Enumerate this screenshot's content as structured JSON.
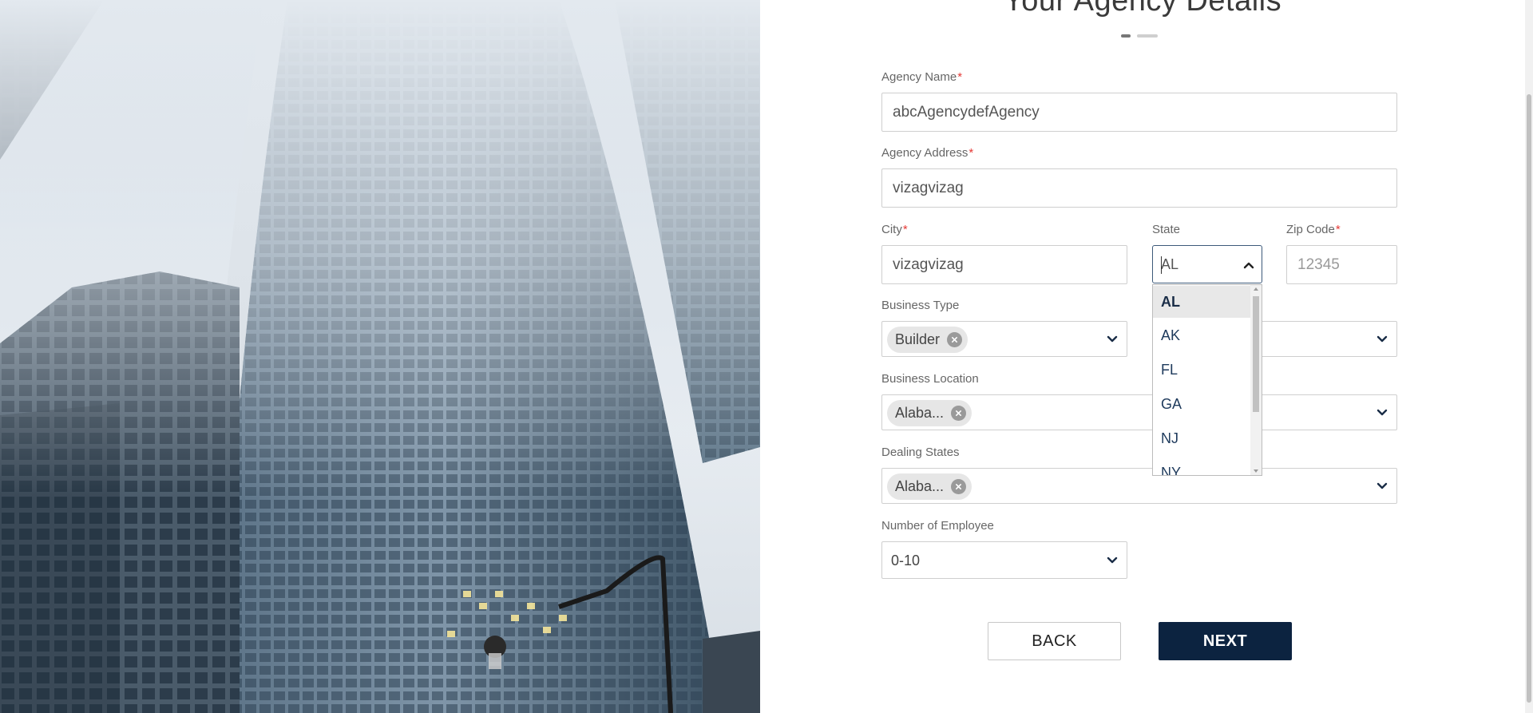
{
  "page": {
    "title": "Your Agency Details",
    "steps": {
      "total": 2,
      "current": 1
    }
  },
  "form": {
    "agency_name": {
      "label": "Agency Name",
      "required_mark": "*",
      "value": "abcAgencydefAgency"
    },
    "agency_address": {
      "label": "Agency Address",
      "required_mark": "*",
      "value": "vizagvizag"
    },
    "city": {
      "label": "City",
      "required_mark": "*",
      "value": "vizagvizag"
    },
    "state": {
      "label": "State",
      "typed_value": "AL",
      "expanded": true,
      "options": [
        "AL",
        "AK",
        "FL",
        "GA",
        "NJ",
        "NY"
      ],
      "highlighted_option": "AL"
    },
    "zip_code": {
      "label": "Zip Code",
      "required_mark": "*",
      "placeholder": "12345"
    },
    "business_type": {
      "label": "Business Type",
      "selected_chip": "Builder"
    },
    "business_location": {
      "label": "Business Location",
      "selected_chip": "Alaba..."
    },
    "dealing_states": {
      "label": "Dealing States",
      "selected_chip": "Alaba..."
    },
    "number_of_employee": {
      "label": "Number of Employee",
      "value": "0-10"
    }
  },
  "buttons": {
    "back": "BACK",
    "next": "NEXT"
  },
  "icons": {
    "chevron_down": "chevron-down-icon",
    "chevron_up": "chevron-up-icon",
    "chip_remove": "close-circle-icon"
  },
  "colors": {
    "primary_navy": "#0c2340",
    "required_red": "#e53935",
    "focus_border": "#3d5a7a",
    "chip_bg": "#e6e6e6",
    "input_border": "#cfcfcf"
  }
}
